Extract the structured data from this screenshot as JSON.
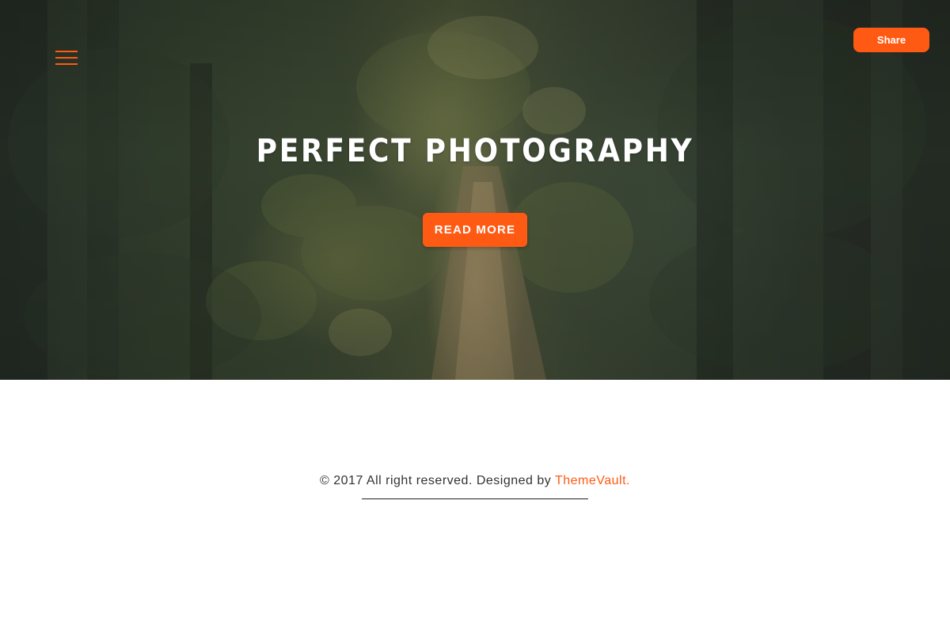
{
  "header": {
    "menu_icon": "hamburger-menu-icon",
    "share_label": "Share"
  },
  "hero": {
    "title": "PERFECT PHOTOGRAPHY",
    "button_label": "READ MORE"
  },
  "footer": {
    "copyright_text": "© 2017 All right reserved. Designed by ",
    "brand_link": "ThemeVault."
  },
  "colors": {
    "accent": "#ff5a14",
    "text": "#333333",
    "background": "#ffffff"
  }
}
